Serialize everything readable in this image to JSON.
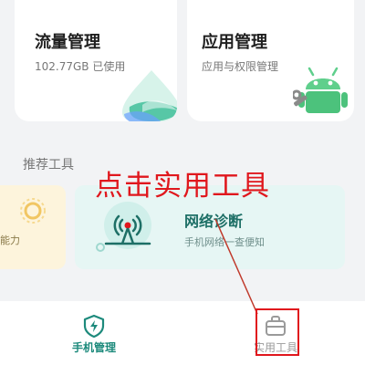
{
  "cards": {
    "traffic": {
      "title": "流量管理",
      "subtitle": "102.77GB 已使用"
    },
    "apps": {
      "title": "应用管理",
      "subtitle": "应用与权限管理"
    }
  },
  "section": {
    "title": "推荐工具"
  },
  "tools": {
    "partial_left": {
      "label": "能力"
    },
    "network": {
      "title": "网络诊断",
      "desc": "手机网络一查便知"
    }
  },
  "annotation": {
    "text": "点击实用工具",
    "color": "#e0171d"
  },
  "bottom_nav": {
    "items": [
      {
        "label": "手机管理",
        "icon": "shield-bolt-icon",
        "active": true
      },
      {
        "label": "实用工具",
        "icon": "toolbox-icon",
        "active": false
      }
    ]
  },
  "colors": {
    "accent": "#1d8a7c",
    "annotation_red": "#e0171d"
  }
}
